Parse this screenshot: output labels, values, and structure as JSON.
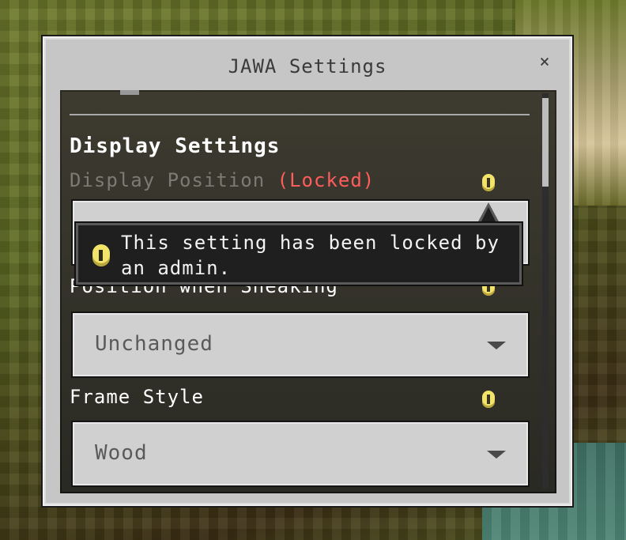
{
  "window": {
    "title": "JAWA Settings",
    "close_label": "×"
  },
  "section": {
    "heading": "Display Settings"
  },
  "settings": [
    {
      "label": "Display Position",
      "locked_badge": "(Locked)",
      "info_icon": "info-icon"
    },
    {
      "label": "Position when Sneaking",
      "value": "Unchanged",
      "info_icon": "info-icon"
    },
    {
      "label": "Frame Style",
      "value": "Wood",
      "info_icon": "info-icon"
    }
  ],
  "tooltip": {
    "text": "This setting has been locked by an admin.",
    "icon": "info-icon"
  },
  "colors": {
    "locked": "#ff5c5c",
    "panel_bg": "#c6c6c6",
    "content_bg": "#2a2a25",
    "dropdown_bg": "#d0d0d0",
    "info_icon": "#f2e36a"
  }
}
